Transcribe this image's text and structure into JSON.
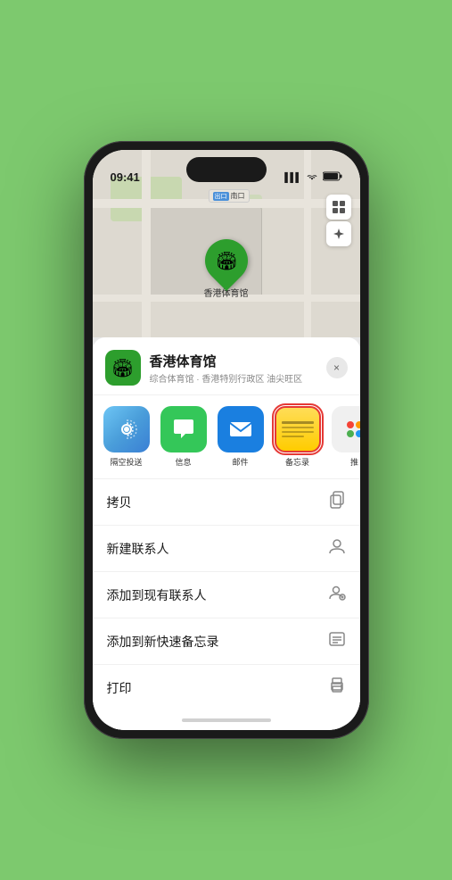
{
  "status": {
    "time": "09:41",
    "signal": "▌▌▌",
    "wifi": "WiFi",
    "battery": "Battery"
  },
  "map": {
    "label_tag": "出口",
    "label_text": "南口",
    "venue_pin_label": "香港体育馆",
    "map_icon": "🗺",
    "location_icon": "⬆"
  },
  "venue": {
    "name": "香港体育馆",
    "subtitle": "综合体育馆 · 香港特别行政区 油尖旺区",
    "logo_emoji": "🏟"
  },
  "share_items": [
    {
      "id": "airdrop",
      "label": "隔空投送",
      "icon_type": "airdrop"
    },
    {
      "id": "messages",
      "label": "信息",
      "icon_type": "messages"
    },
    {
      "id": "mail",
      "label": "邮件",
      "icon_type": "mail"
    },
    {
      "id": "notes",
      "label": "备忘录",
      "icon_type": "notes"
    },
    {
      "id": "more",
      "label": "推",
      "icon_type": "more"
    }
  ],
  "actions": [
    {
      "id": "copy",
      "label": "拷贝",
      "icon": "📋"
    },
    {
      "id": "new-contact",
      "label": "新建联系人",
      "icon": "👤"
    },
    {
      "id": "add-existing",
      "label": "添加到现有联系人",
      "icon": "👤"
    },
    {
      "id": "add-notes",
      "label": "添加到新快速备忘录",
      "icon": "⊟"
    },
    {
      "id": "print",
      "label": "打印",
      "icon": "🖨"
    }
  ],
  "close_label": "×"
}
